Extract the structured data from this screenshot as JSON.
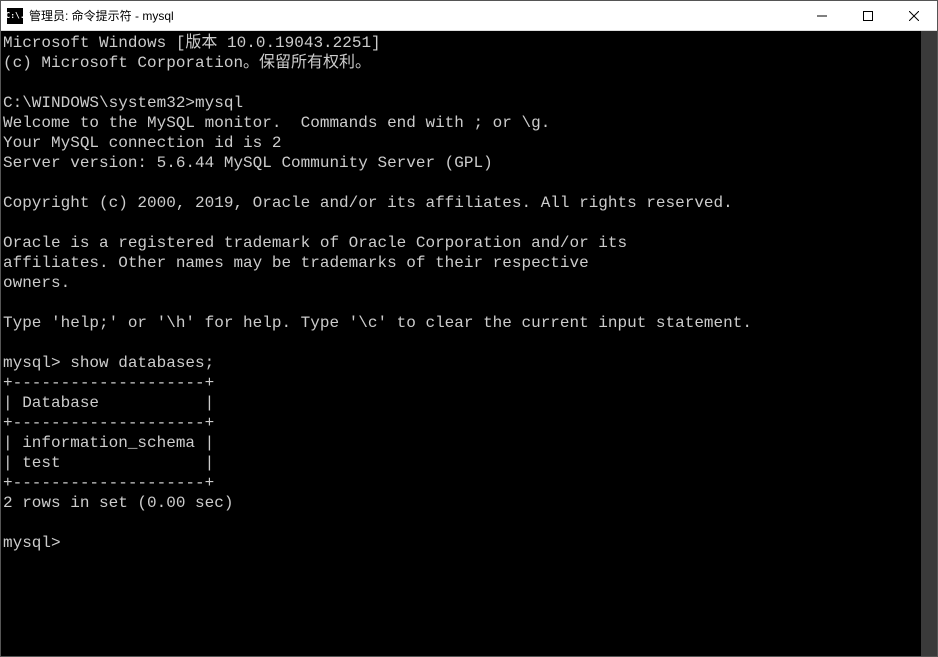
{
  "window": {
    "title": "管理员: 命令提示符 - mysql",
    "icon_label": "C:\\."
  },
  "terminal": {
    "line_winver": "Microsoft Windows [版本 10.0.19043.2251]",
    "line_copyright_ms": "(c) Microsoft Corporation。保留所有权利。",
    "prompt_path": "C:\\WINDOWS\\system32>",
    "cmd_mysql": "mysql",
    "welcome1": "Welcome to the MySQL monitor.  Commands end with ; or \\g.",
    "welcome2": "Your MySQL connection id is 2",
    "welcome3": "Server version: 5.6.44 MySQL Community Server (GPL)",
    "copyright_oracle": "Copyright (c) 2000, 2019, Oracle and/or its affiliates. All rights reserved.",
    "trademark1": "Oracle is a registered trademark of Oracle Corporation and/or its",
    "trademark2": "affiliates. Other names may be trademarks of their respective",
    "trademark3": "owners.",
    "help_line": "Type 'help;' or '\\h' for help. Type '\\c' to clear the current input statement.",
    "mysql_prompt": "mysql>",
    "cmd_show": " show databases;",
    "table_border": "+--------------------+",
    "table_header": "| Database           |",
    "table_row1": "| information_schema |",
    "table_row2": "| test               |",
    "rows_summary": "2 rows in set (0.00 sec)",
    "mysql_prompt2": "mysql>"
  }
}
